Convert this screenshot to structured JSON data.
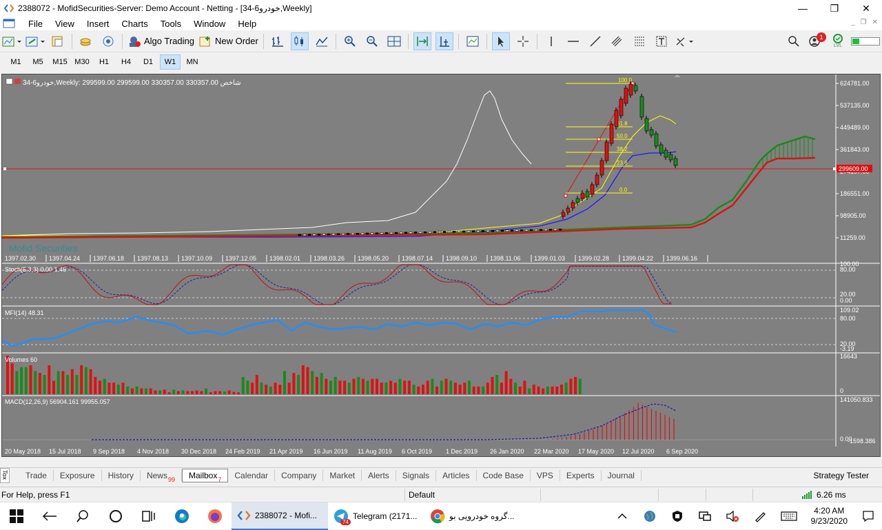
{
  "window": {
    "title": "2388072 - MofidSecurities-Server: Demo Account - Netting - [34-6خودرو,Weekly]",
    "minimize": "—",
    "restore": "❐",
    "close": "✕"
  },
  "menu": {
    "items": [
      "File",
      "View",
      "Insert",
      "Charts",
      "Tools",
      "Window",
      "Help"
    ],
    "mdi_minimize": "_",
    "mdi_restore": "❐",
    "mdi_close": "✕"
  },
  "toolbar": {
    "algo_trading": "Algo Trading",
    "new_order": "New Order",
    "notification_count": "1",
    "lvl": "LVL"
  },
  "timeframes": [
    "M1",
    "M5",
    "M15",
    "M30",
    "H1",
    "H4",
    "D1",
    "W1",
    "MN"
  ],
  "active_timeframe": "W1",
  "chart": {
    "header": "34-6خودرو,Weekly:  299599.00 299599.00 330357.00 330357.00  شاخص",
    "watermark": "Mofid Securities",
    "price_labels": [
      "624781.00",
      "537135.00",
      "449489.00",
      "361843.00",
      "274197.00",
      "186551.00",
      "98905.00",
      "11259.00"
    ],
    "current_price": "299609.00",
    "top_dates": [
      "1397.02.30",
      "1397.04.24",
      "1397.06.18",
      "1397.08.13",
      "1397.10.09",
      "1397.12.05",
      "1398.02.01",
      "1398.03.26",
      "1398.05.20",
      "1398.07.14",
      "1398.09.10",
      "1398.11.06",
      "1399.01.03",
      "1399.02.28",
      "1399.04.22",
      "1399.06.16"
    ],
    "fib_levels": [
      "100.0",
      "61.8",
      "50.0",
      "38.2",
      "23.6",
      "0.0"
    ],
    "stoch_label": "Stoch(5,3,3) 0.00 1.46",
    "stoch_scale": [
      "100.00",
      "80.00",
      "20.00",
      "0.00"
    ],
    "mfi_label": "MFI(14) 48.31",
    "mfi_scale": [
      "109.02",
      "80.00",
      "20.00",
      "-3.19"
    ],
    "volumes_label": "Volumes 60",
    "volumes_scale": [
      "16643",
      "0"
    ],
    "macd_label": "MACD(12,26,9) 56904.161 99955.057",
    "macd_scale": [
      "141050.833",
      "0.00",
      "-1598.386"
    ],
    "bottom_dates": [
      "20 May 2018",
      "15 Jul 2018",
      "9 Sep 2018",
      "4 Nov 2018",
      "30 Dec 2018",
      "24 Feb 2019",
      "21 Apr 2019",
      "16 Jun 2019",
      "11 Aug 2019",
      "6 Oct 2019",
      "1 Dec 2019",
      "26 Jan 2020",
      "22 Mar 2020",
      "17 May 2020",
      "12 Jul 2020",
      "6 Sep 2020"
    ]
  },
  "colors": {
    "chart_bg": "#808080",
    "bull": "#1a8a1a",
    "bear": "#e01010",
    "mfi": "#1e90ff",
    "fib": "#ffff00",
    "price_line": "#e01010"
  },
  "bottom_tabs": {
    "items": [
      {
        "label": "Trade",
        "badge": ""
      },
      {
        "label": "Exposure",
        "badge": ""
      },
      {
        "label": "History",
        "badge": ""
      },
      {
        "label": "News",
        "badge": "99"
      },
      {
        "label": "Mailbox",
        "badge": "7"
      },
      {
        "label": "Calendar",
        "badge": ""
      },
      {
        "label": "Company",
        "badge": ""
      },
      {
        "label": "Market",
        "badge": ""
      },
      {
        "label": "Alerts",
        "badge": ""
      },
      {
        "label": "Signals",
        "badge": ""
      },
      {
        "label": "Articles",
        "badge": ""
      },
      {
        "label": "Code Base",
        "badge": ""
      },
      {
        "label": "VPS",
        "badge": ""
      },
      {
        "label": "Experts",
        "badge": ""
      },
      {
        "label": "Journal",
        "badge": ""
      }
    ],
    "active": "Mailbox",
    "toolbox": "Tox",
    "strategy_tester": "Strategy Tester"
  },
  "status": {
    "help": "For Help, press F1",
    "profile": "Default",
    "ping": "6.26 ms"
  },
  "taskbar": {
    "apps": [
      {
        "label": "2388072 - Mofi...",
        "icon": "metatrader-icon"
      },
      {
        "label": "Telegram (2171...",
        "icon": "telegram-icon",
        "badge": "74"
      },
      {
        "label": "گروه خودرویی بو...",
        "icon": "chrome-icon"
      }
    ],
    "time": "4:20 AM",
    "date": "9/23/2020"
  }
}
